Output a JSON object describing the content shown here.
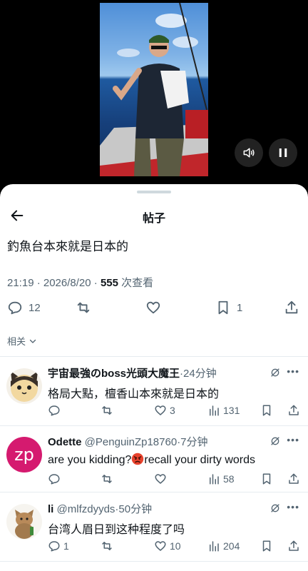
{
  "video": {
    "controls": [
      "volume-icon",
      "pause-icon"
    ]
  },
  "header": {
    "title": "帖子",
    "back_icon": "arrow-left-icon"
  },
  "post": {
    "text": "釣魚台本來就是日本的",
    "time": "21:19 · 2026/8/20 · ",
    "views": "555",
    "views_label": " 次查看",
    "replies": "12",
    "likes": "",
    "bookmarks": "1"
  },
  "related_label": "相关",
  "replies": [
    {
      "name": "宇宙最強のboss光頭大魔王",
      "handle": "",
      "time": "·24分钟",
      "text": "格局大點，檀香山本來就是日本的",
      "reply_count": "",
      "like_count": "3",
      "view_count": "131"
    },
    {
      "name": "Odette",
      "handle": " @PenguinZp18760",
      "time": "·7分钟",
      "text_pre": "are you kidding?",
      "text_post": "recall your dirty words",
      "avatar_text": "zp",
      "reply_count": "",
      "like_count": "",
      "view_count": "58"
    },
    {
      "name": "li",
      "handle": " @mlfzdyyds",
      "time": "·50分钟",
      "text": "台湾人眉日到这种程度了吗",
      "reply_count": "1",
      "like_count": "10",
      "view_count": "204"
    }
  ],
  "colors": {
    "accent": "#1d9bf0",
    "muted": "#536471",
    "avatar_zp": "#d51a6f"
  }
}
